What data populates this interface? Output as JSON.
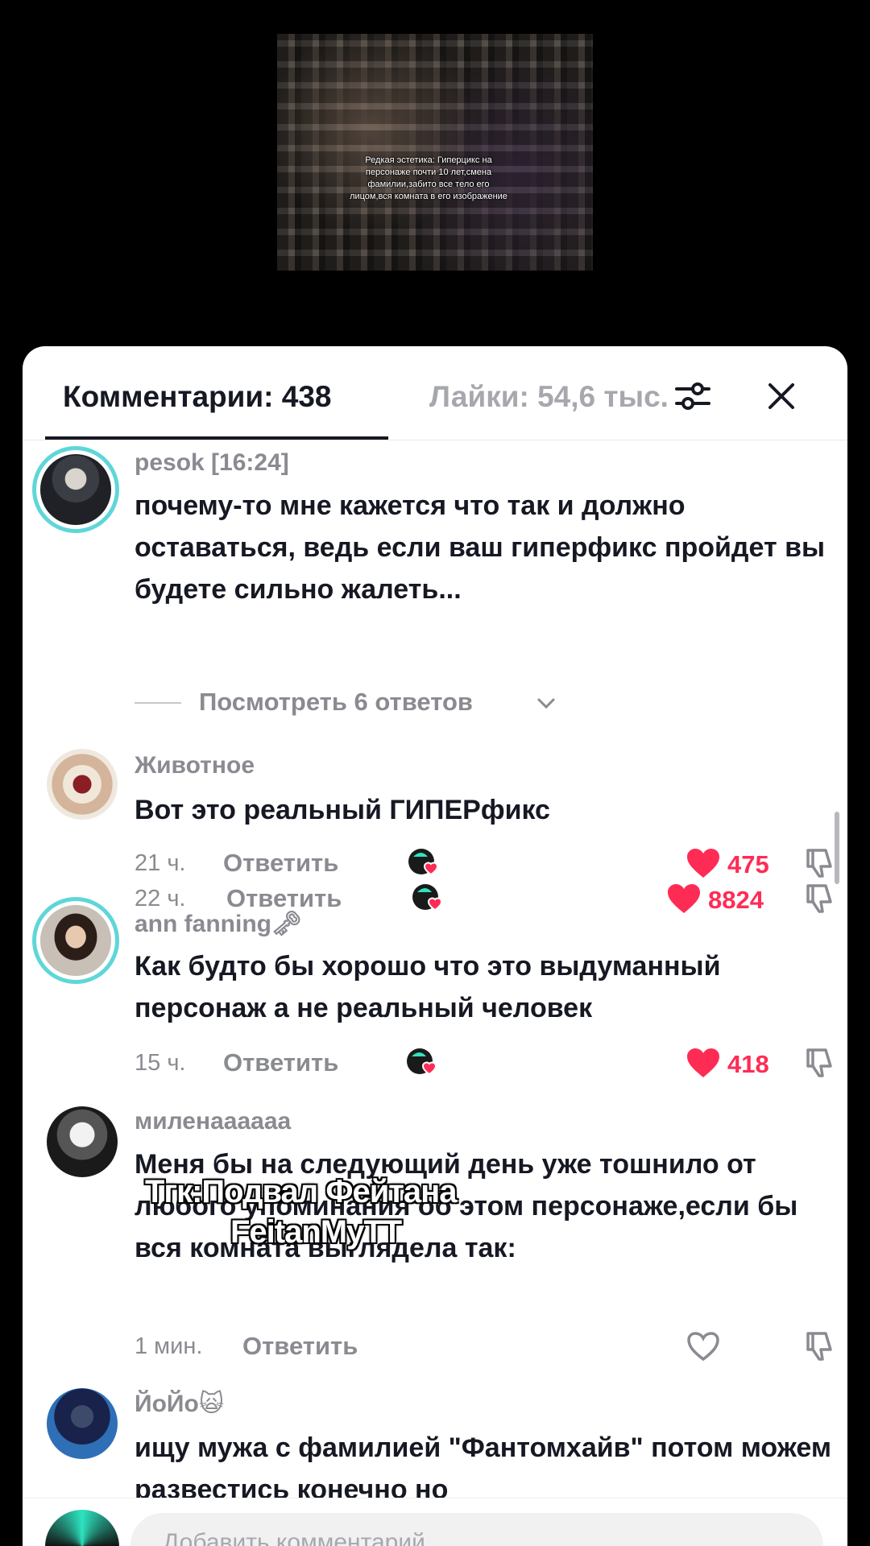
{
  "video": {
    "caption": "Редкая эстетика: Гиперцикс на персонаже почти 10 лет,смена фамилии,забито все тело его лицом,вся комната в его изображение"
  },
  "tabs": {
    "comments": "Комментарии: 438",
    "likes": "Лайки: 54,6 тыс."
  },
  "comments": [
    {
      "username": "pesok [16:24]",
      "text": "почему-то мне кажется что так и должно оставаться, ведь если ваш гиперфикс пройдет вы будете сильно жалеть...",
      "time": "22 ч.",
      "reply": "Ответить",
      "likes": "8824",
      "view_replies": "Посмотреть 6 ответов"
    },
    {
      "username": "Животное",
      "text": "Вот это реальный ГИПЕРфикс",
      "time": "21 ч.",
      "reply": "Ответить",
      "likes": "475"
    },
    {
      "username": "ann fanning🗝",
      "text": "Как будто бы хорошо что это выдуманный персонаж а не реальный человек",
      "time": "15 ч.",
      "reply": "Ответить",
      "likes": "418"
    },
    {
      "username": "миленаааааа",
      "text": "Меня бы на следующий день уже тошнило от любого упоминания об этом персонаже,если бы вся комната выглядела так:",
      "time": "1 мин.",
      "reply": "Ответить",
      "likes": ""
    },
    {
      "username": "ЙоЙо🙀",
      "text": "ищу мужа с фамилией \"Фантомхайв\" потом можем развестись конечно но",
      "time": "",
      "reply": ""
    }
  ],
  "overlay": {
    "line1": "Тгк:Подвал Фейтана",
    "line2": "FeitanMyTT"
  },
  "input": {
    "placeholder": "Добавить комментарий..."
  },
  "colors": {
    "accent_red": "#fe2c55",
    "muted_gray": "#8a8b91",
    "ring_cyan": "#5fd6d8"
  },
  "icons": {
    "filter": "sliders-icon",
    "close": "close-icon",
    "like": "heart-icon",
    "dislike": "thumbs-down-icon",
    "creator_like": "creator-liked-icon"
  }
}
